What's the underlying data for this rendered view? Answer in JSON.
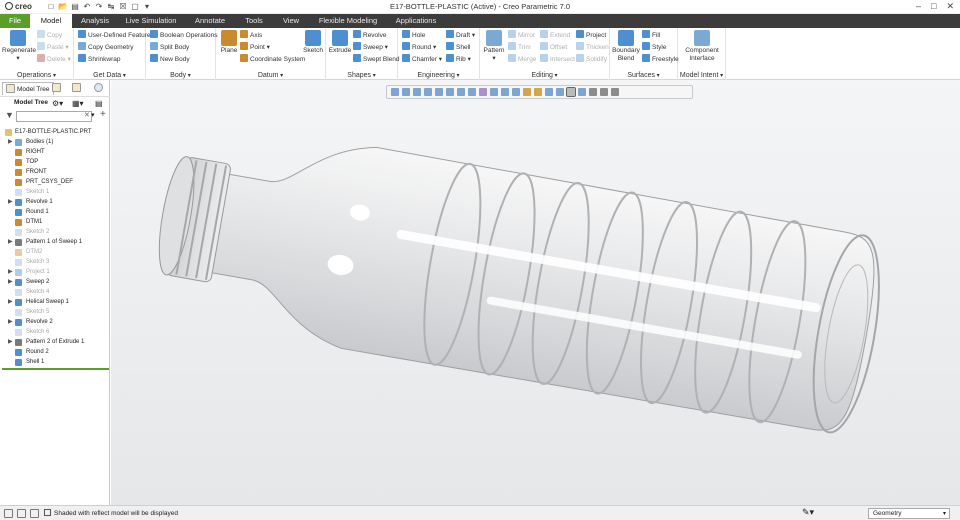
{
  "app": {
    "brand": "creo",
    "title": "E17-BOTTLE-PLASTIC (Active) - Creo Parametric 7.0"
  },
  "tabs": [
    "File",
    "Model",
    "Analysis",
    "Live Simulation",
    "Annotate",
    "Tools",
    "View",
    "Flexible Modeling",
    "Applications"
  ],
  "ribbon": {
    "operations": {
      "label": "Operations",
      "regenerate": "Regenerate",
      "copy": "Copy",
      "paste": "Paste",
      "delete": "Delete"
    },
    "get_data": {
      "label": "Get Data",
      "udf": "User-Defined Feature",
      "copy_geometry": "Copy Geometry",
      "shrinkwrap": "Shrinkwrap"
    },
    "body": {
      "label": "Body",
      "boolean": "Boolean Operations",
      "split": "Split Body",
      "new": "New Body"
    },
    "datum": {
      "label": "Datum",
      "plane": "Plane",
      "axis": "Axis",
      "point": "Point",
      "csys": "Coordinate System",
      "sketch": "Sketch"
    },
    "shapes": {
      "label": "Shapes",
      "extrude": "Extrude",
      "revolve": "Revolve",
      "sweep": "Sweep",
      "swept_blend": "Swept Blend"
    },
    "engineering": {
      "label": "Engineering",
      "hole": "Hole",
      "round": "Round",
      "chamfer": "Chamfer",
      "draft": "Draft",
      "shell": "Shell",
      "rib": "Rib"
    },
    "editing": {
      "label": "Editing",
      "pattern": "Pattern",
      "mirror": "Mirror",
      "trim": "Trim",
      "merge": "Merge",
      "extend": "Extend",
      "offset": "Offset",
      "intersect": "Intersect",
      "project": "Project",
      "thicken": "Thicken",
      "solidify": "Solidify"
    },
    "surfaces": {
      "label": "Surfaces",
      "boundary_blend": "Boundary Blend",
      "fill": "Fill",
      "style": "Style",
      "freestyle": "Freestyle"
    },
    "model_intent": {
      "label": "Model Intent",
      "component_interface": "Component Interface"
    }
  },
  "panel": {
    "tab": "Model Tree",
    "header": "Model Tree",
    "filter_placeholder": "",
    "tree": [
      {
        "label": "E17-BOTTLE-PLASTIC.PRT",
        "root": true,
        "icon": "part",
        "expand": false,
        "disabled": false
      },
      {
        "label": "Bodies (1)",
        "icon": "bodies",
        "expand": true,
        "disabled": false
      },
      {
        "label": "RIGHT",
        "icon": "plane",
        "expand": false,
        "disabled": false
      },
      {
        "label": "TOP",
        "icon": "plane",
        "expand": false,
        "disabled": false
      },
      {
        "label": "FRONT",
        "icon": "plane",
        "expand": false,
        "disabled": false
      },
      {
        "label": "PRT_CSYS_DEF",
        "icon": "csys",
        "expand": false,
        "disabled": false
      },
      {
        "label": "Sketch 1",
        "icon": "sketch",
        "expand": false,
        "disabled": true
      },
      {
        "label": "Revolve 1",
        "icon": "revolve",
        "expand": true,
        "disabled": false
      },
      {
        "label": "Round 1",
        "icon": "round",
        "expand": false,
        "disabled": false
      },
      {
        "label": "DTM1",
        "icon": "plane",
        "expand": false,
        "disabled": false
      },
      {
        "label": "Sketch 2",
        "icon": "sketch",
        "expand": false,
        "disabled": true
      },
      {
        "label": "Pattern 1 of Sweep 1",
        "icon": "pattern",
        "expand": true,
        "disabled": false
      },
      {
        "label": "DTM2",
        "icon": "plane",
        "expand": false,
        "disabled": true
      },
      {
        "label": "Sketch 3",
        "icon": "sketch",
        "expand": false,
        "disabled": true
      },
      {
        "label": "Project 1",
        "icon": "project",
        "expand": true,
        "disabled": true
      },
      {
        "label": "Sweep 2",
        "icon": "sweep",
        "expand": true,
        "disabled": false
      },
      {
        "label": "Sketch 4",
        "icon": "sketch",
        "expand": false,
        "disabled": true
      },
      {
        "label": "Helical Sweep 1",
        "icon": "helical",
        "expand": true,
        "disabled": false
      },
      {
        "label": "Sketch 5",
        "icon": "sketch",
        "expand": false,
        "disabled": true
      },
      {
        "label": "Revolve 2",
        "icon": "revolve",
        "expand": true,
        "disabled": false
      },
      {
        "label": "Sketch 6",
        "icon": "sketch",
        "expand": false,
        "disabled": true
      },
      {
        "label": "Pattern 2 of Extrude 1",
        "icon": "pattern",
        "expand": true,
        "disabled": false
      },
      {
        "label": "Round 2",
        "icon": "round",
        "expand": false,
        "disabled": false
      },
      {
        "label": "Shell 1",
        "icon": "shell",
        "expand": false,
        "disabled": false
      }
    ]
  },
  "status": {
    "message": "Shaded with reflect model will be displayed",
    "filter": "Geometry"
  },
  "colors": {
    "file_tab": "#5a9e2a",
    "tabbar": "#3c3c3c",
    "viewport_top": "#f4f5f6",
    "viewport_bottom": "#e6e7e9"
  }
}
